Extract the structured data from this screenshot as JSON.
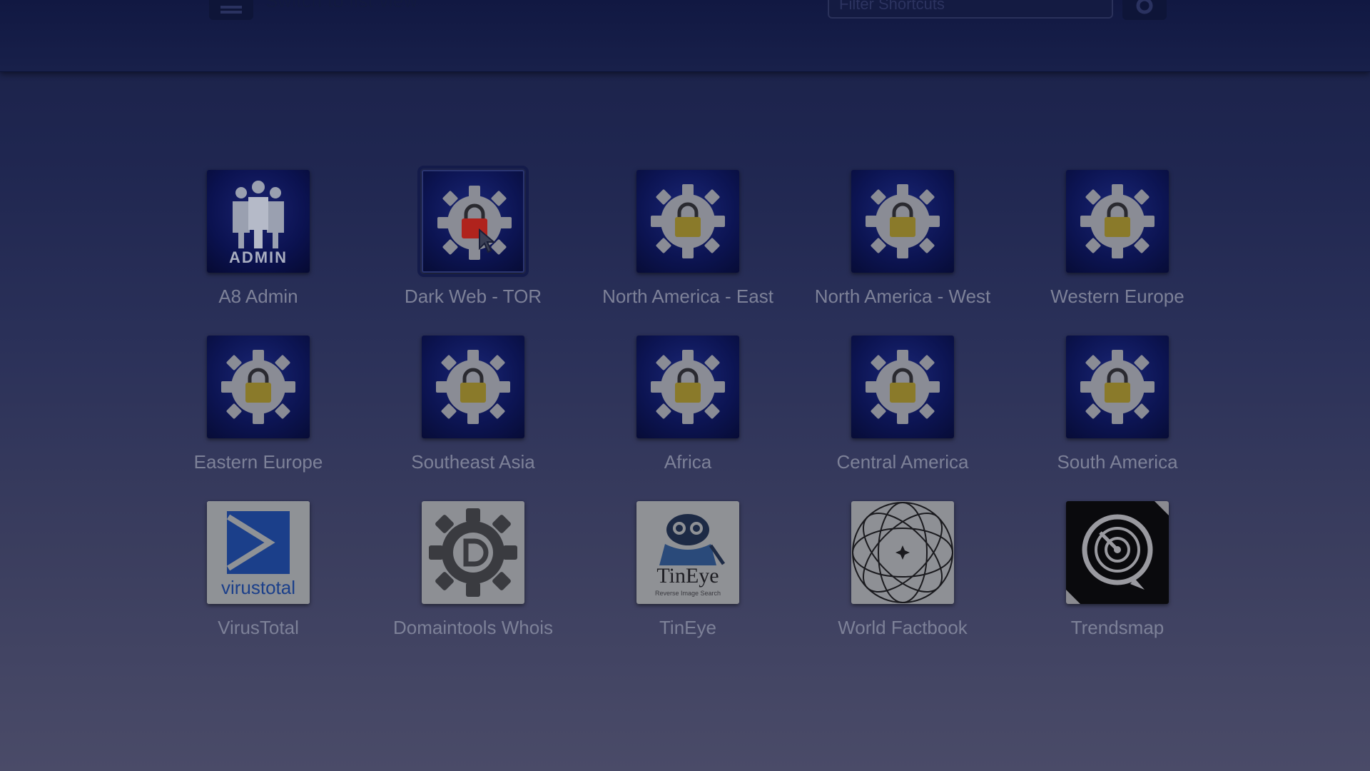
{
  "header": {
    "switch_label": "Switch to list view",
    "filter_placeholder": "Filter Shortcuts"
  },
  "tiles": [
    {
      "label": "A8 Admin",
      "icon": "admin-icon"
    },
    {
      "label": "Dark Web - TOR",
      "icon": "gear-lock-icon",
      "lock_color": "#b0231d",
      "selected": true
    },
    {
      "label": "North America - East",
      "icon": "gear-lock-icon",
      "lock_color": "#8a7a2a"
    },
    {
      "label": "North America - West",
      "icon": "gear-lock-icon",
      "lock_color": "#8a7a2a"
    },
    {
      "label": "Western Europe",
      "icon": "gear-lock-icon",
      "lock_color": "#8a7a2a"
    },
    {
      "label": "Eastern Europe",
      "icon": "gear-lock-icon",
      "lock_color": "#8a7a2a"
    },
    {
      "label": "Southeast Asia",
      "icon": "gear-lock-icon",
      "lock_color": "#8a7a2a"
    },
    {
      "label": "Africa",
      "icon": "gear-lock-icon",
      "lock_color": "#8a7a2a"
    },
    {
      "label": "Central America",
      "icon": "gear-lock-icon",
      "lock_color": "#8a7a2a"
    },
    {
      "label": "South America",
      "icon": "gear-lock-icon",
      "lock_color": "#8a7a2a"
    },
    {
      "label": "VirusTotal",
      "icon": "virustotal-logo-icon",
      "logo_text": "virustotal"
    },
    {
      "label": "Domaintools Whois",
      "icon": "domaintools-gear-icon"
    },
    {
      "label": "TinEye",
      "icon": "tineye-robot-icon",
      "logo_text": "TinEye",
      "logo_subtext": "Reverse Image Search"
    },
    {
      "label": "World Factbook",
      "icon": "world-factbook-icon"
    },
    {
      "label": "Trendsmap",
      "icon": "trendsmap-radar-icon"
    }
  ]
}
